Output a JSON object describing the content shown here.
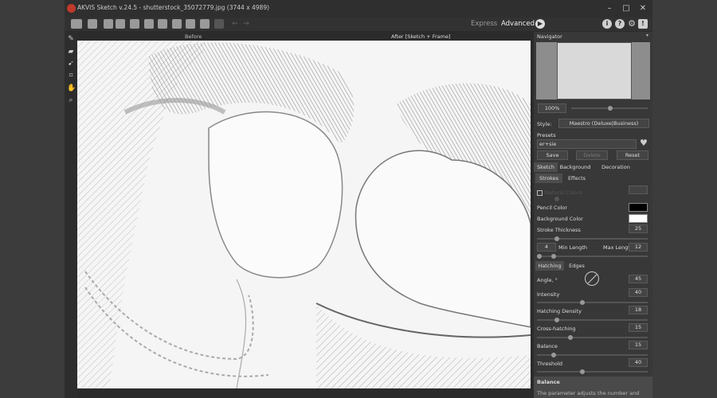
{
  "window": {
    "title": "AKVIS Sketch v.24.5 - shutterstock_35072779.jpg (3744 x 4989)"
  },
  "modes": {
    "express": "Express",
    "advanced": "Advanced"
  },
  "canvas_labels": {
    "before": "Before",
    "after": "After [Sketch + Frame]"
  },
  "navigator": {
    "title": "Navigator",
    "zoom": "100%"
  },
  "style": {
    "label": "Style:",
    "value": "Maestro (Deluxe|Business)"
  },
  "presets": {
    "label": "Presets",
    "value": "er+sie",
    "save": "Save",
    "delete": "Delete",
    "reset": "Reset"
  },
  "main_tabs": [
    "Sketch",
    "Background",
    "Decoration"
  ],
  "sub_tabs": [
    "Strokes",
    "Effects"
  ],
  "strokes": {
    "natural_colors": "Natural Colors",
    "pencil_color_label": "Pencil Color",
    "pencil_color": "#000000",
    "background_color_label": "Background Color",
    "background_color": "#ffffff",
    "stroke_thickness_label": "Stroke Thickness",
    "stroke_thickness": "25",
    "min_length": "4",
    "min_length_label": "Min Length",
    "max_length_label": "Max Length",
    "max_length": "12"
  },
  "hatch_tabs": [
    "Hatching",
    "Edges"
  ],
  "hatching": {
    "angle_label": "Angle, °",
    "angle": "45",
    "intensity_label": "Intensity",
    "intensity": "40",
    "density_label": "Hatching Density",
    "density": "18",
    "cross_label": "Cross-hatching",
    "cross": "15",
    "balance_label": "Balance",
    "balance": "15",
    "threshold_label": "Threshold",
    "threshold": "40"
  },
  "help": {
    "title": "Balance",
    "text": "The parameter adjusts the number and"
  },
  "colors": {
    "accent": "#c0392b",
    "panel": "#383838",
    "window": "#2b2b2b"
  }
}
